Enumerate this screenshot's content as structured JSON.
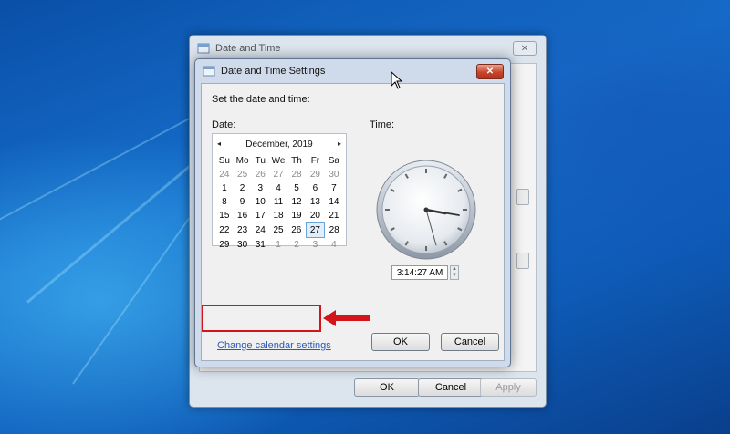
{
  "outer_dialog": {
    "title": "Date and Time",
    "close_glyph": "✕",
    "buttons": {
      "ok": "OK",
      "cancel": "Cancel",
      "apply": "Apply"
    }
  },
  "inner_dialog": {
    "title": "Date and Time Settings",
    "close_glyph": "✕",
    "instruction": "Set the date and time:",
    "date_label": "Date:",
    "time_label": "Time:",
    "calendar": {
      "prev_glyph": "◂",
      "next_glyph": "▸",
      "month_label": "December, 2019",
      "weekdays": [
        "Su",
        "Mo",
        "Tu",
        "We",
        "Th",
        "Fr",
        "Sa"
      ],
      "weeks": [
        [
          "24",
          "25",
          "26",
          "27",
          "28",
          "29",
          "30"
        ],
        [
          "1",
          "2",
          "3",
          "4",
          "5",
          "6",
          "7"
        ],
        [
          "8",
          "9",
          "10",
          "11",
          "12",
          "13",
          "14"
        ],
        [
          "15",
          "16",
          "17",
          "18",
          "19",
          "20",
          "21"
        ],
        [
          "22",
          "23",
          "24",
          "25",
          "26",
          "27",
          "28"
        ],
        [
          "29",
          "30",
          "31",
          "1",
          "2",
          "3",
          "4"
        ]
      ],
      "selected_day": "27"
    },
    "time_value": "3:14:27 AM",
    "spinner_up": "▲",
    "spinner_down": "▼",
    "change_calendar_link": "Change calendar settings",
    "buttons": {
      "ok": "OK",
      "cancel": "Cancel"
    }
  },
  "colors": {
    "highlight_box": "#d3141a",
    "link": "#2a5ab8",
    "desktop": "#1670cc"
  }
}
